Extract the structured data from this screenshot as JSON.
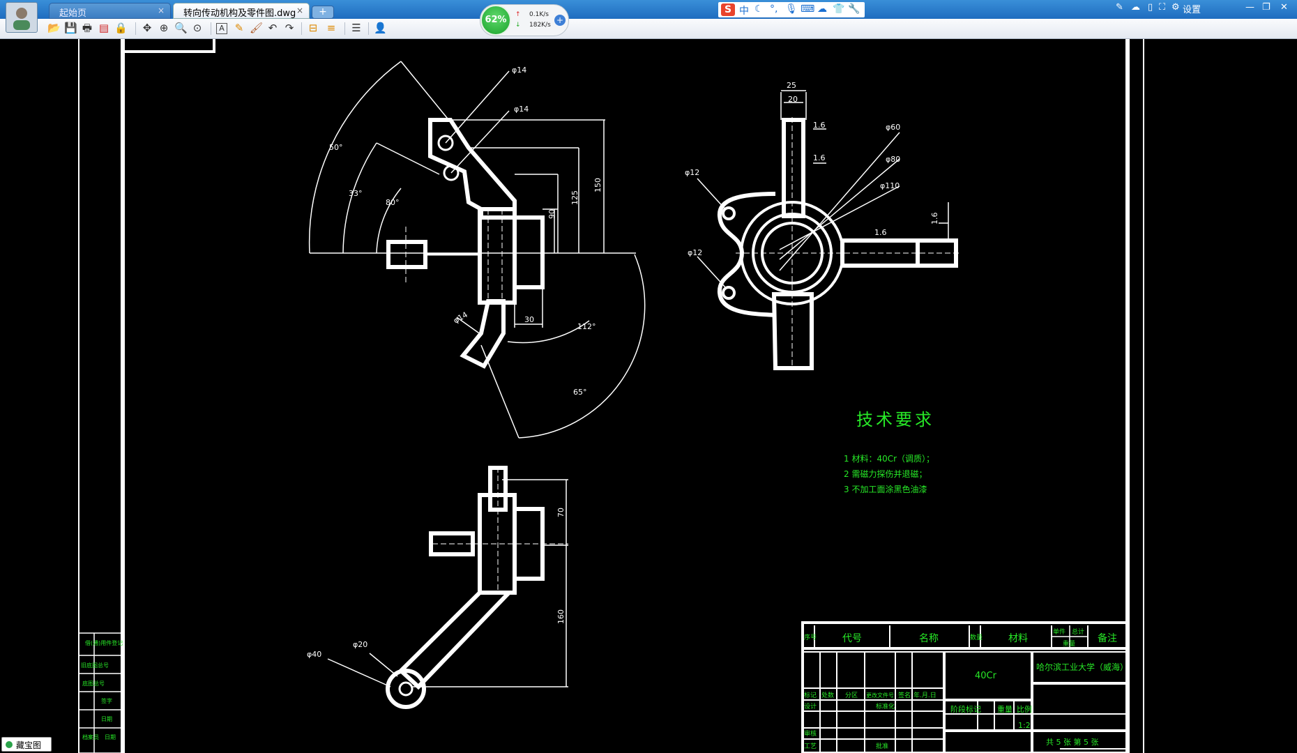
{
  "tabs": [
    {
      "label": "起始页",
      "close": "×"
    },
    {
      "label": "转向传动机构及零件图.dwg",
      "close": "×"
    }
  ],
  "new_tab_label": "+",
  "net": {
    "percent": "62%",
    "up": "0.1K/s",
    "down": "182K/s",
    "up_icon": "arrow-up-icon",
    "down_icon": "arrow-down-icon"
  },
  "ime": {
    "logo": "S",
    "mode": "中"
  },
  "window": {
    "settings_label": "设置"
  },
  "toolbar_icons": [
    "open-icon",
    "save-icon",
    "print-icon",
    "pdf-icon",
    "lock-icon",
    "pan-icon",
    "zoom-window-icon",
    "zoom-realtime-icon",
    "zoom-extents-icon",
    "text-icon",
    "pencil-icon",
    "brush-icon",
    "undo-icon",
    "redo-icon",
    "measure-icon",
    "measure-multi-icon",
    "layers-icon",
    "user-icon"
  ],
  "status": {
    "label": "藏宝图"
  },
  "drawing": {
    "dimensions": {
      "d14a": "φ14",
      "d14b": "φ14",
      "d14c": "φ14",
      "a50": "50°",
      "a33": "33°",
      "a80": "80°",
      "l150": "150",
      "l125": "125",
      "l90": "90",
      "l30": "30",
      "a112": "112°",
      "a65": "65°",
      "l25": "25",
      "l20": "20",
      "r16a": "1.6",
      "r16b": "1.6",
      "r16c": "1.6",
      "r16d": "1.6",
      "d60": "φ60",
      "d80": "φ80",
      "d110": "φ110",
      "d12a": "φ12",
      "d12b": "φ12",
      "l70": "70",
      "l160": "160",
      "d40": "φ40",
      "d20": "φ20"
    },
    "tech": {
      "title": "技术要求",
      "items": [
        "1 材料：40Cr（调质）；",
        "2 需磁力探伤并退磁；",
        "3 不加工面涂黑色油漆"
      ]
    },
    "titleblock": {
      "seq": "序号",
      "code": "代号",
      "name": "名称",
      "qty": "数量",
      "material_h": "材料",
      "single": "单件",
      "total": "总计",
      "weight": "重量",
      "remark": "备注",
      "material": "40Cr",
      "school": "哈尔滨工业大学（威海）",
      "stage_mark": "阶段标记",
      "mass": "重量",
      "scale_h": "比例",
      "scale": "1:2",
      "sheets": "共 5 张  第 5 张",
      "mark": "标记",
      "count": "处数",
      "zone": "分区",
      "docno": "更改文件号",
      "sign": "签名",
      "date": "年.月.日",
      "design": "设计",
      "std": "标准化",
      "check": "审核",
      "process": "工艺",
      "approve": "批准"
    },
    "sidebar_labels": [
      "借(通)用件登记",
      "旧底图总号",
      "底图总号",
      "签字",
      "日期",
      "档案员",
      "日期"
    ]
  }
}
